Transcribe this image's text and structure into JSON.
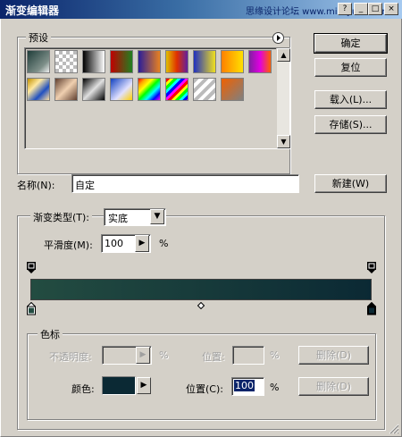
{
  "window": {
    "title": "渐变编辑器",
    "watermark": "思缘设计论坛 www.missyuan.com"
  },
  "title_buttons": {
    "help": "?",
    "minimize": "_",
    "maximize": "□",
    "close": "×"
  },
  "presets": {
    "label": "预设",
    "menu_icon": "right-arrow-circle-icon",
    "swatches": [
      "linear-gradient(135deg,#1f3d3a,#7e8f89 70%,#f0f0f0)",
      "repeating-conic-gradient(#bbb 0% 25%, #fff 0% 50%) 0 0/8px 8px",
      "linear-gradient(90deg,#000,#fff)",
      "linear-gradient(90deg,#c00000,#208020)",
      "linear-gradient(90deg,#2a1e9a,#e88020)",
      "linear-gradient(90deg,#e0c000,#e03000,#6020a0)",
      "linear-gradient(90deg,#2030c0,#f0e020)",
      "linear-gradient(90deg,#ff8000,#ffe000)",
      "linear-gradient(90deg,#8020a0,#e000e0,#ff6000)",
      "linear-gradient(135deg,#c09000,#ffe8a0,#2050c0,#ffe0a0)",
      "linear-gradient(135deg,#604030,#f0d0b0,#604030)",
      "linear-gradient(135deg,#000,#e0e0e0 50%,#000)",
      "linear-gradient(135deg,#1040c0,#e0e0ff 60%,#ffd000)",
      "linear-gradient(135deg,red,orange,yellow,lime,cyan,blue,magenta)",
      "repeating-linear-gradient(135deg,red 0 3px,yellow 3px 6px,lime 6px 9px,cyan 9px 12px,blue 12px 15px,magenta 15px 18px)",
      "repeating-linear-gradient(135deg,#bbb 0 4px,#fff 4px 8px)",
      "linear-gradient(135deg,#f06000,#808080)"
    ]
  },
  "buttons": {
    "ok": "确定",
    "reset": "复位",
    "load": "载入(L)...",
    "save": "存储(S)...",
    "new": "新建(W)"
  },
  "name": {
    "label": "名称(N):",
    "value": "自定"
  },
  "gradient": {
    "type_label": "渐变类型(T):",
    "type_value": "实底",
    "smoothness_label": "平滑度(M):",
    "smoothness_value": "100",
    "percent": "%",
    "start_color": "#234c41",
    "end_color": "#0b2934"
  },
  "stops": {
    "group_label": "色标",
    "opacity_label": "不透明度:",
    "opacity_value": "",
    "location_label": "位置:",
    "location_value": "",
    "delete_label": "删除(D)",
    "color_label": "颜色:",
    "color_value": "#0b2934",
    "color_location_label": "位置(C):",
    "color_location_value": "100",
    "percent": "%"
  }
}
